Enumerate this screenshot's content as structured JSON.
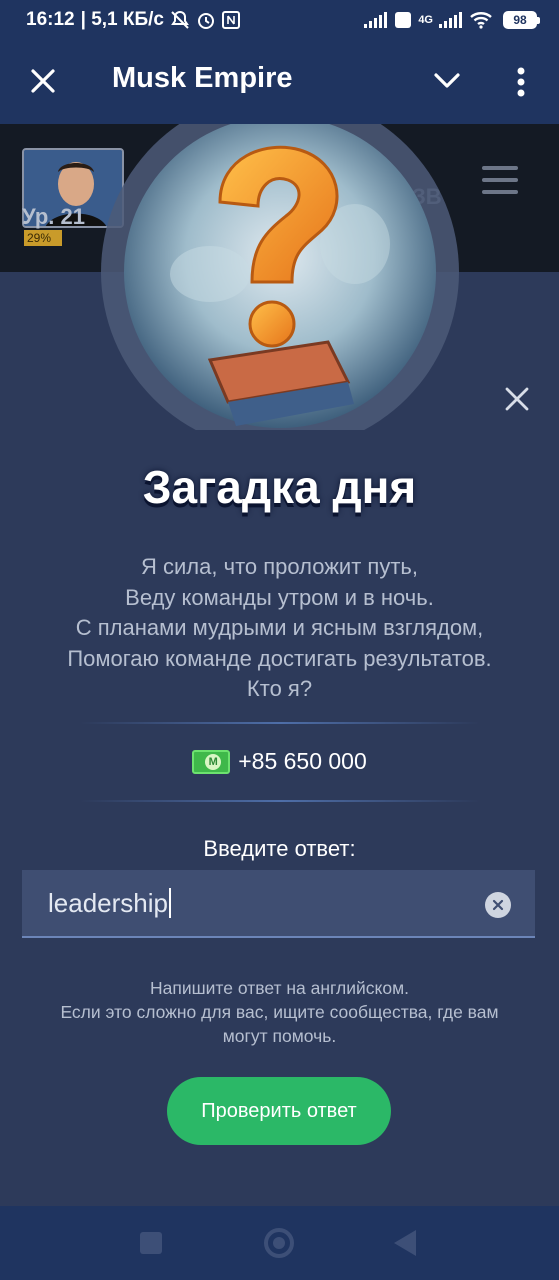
{
  "status_bar": {
    "time": "16:12",
    "network_speed": "| 5,1 КБ/с",
    "battery": "98",
    "network_type": "4G"
  },
  "app_bar": {
    "title": "Musk Empire"
  },
  "game_header": {
    "level": "Ур. 21",
    "level_progress": "29%",
    "faded_text": "ЗВ"
  },
  "modal": {
    "heading": "Загадка дня",
    "riddle_lines": [
      "Я сила, что проложит путь,",
      "Веду команды утром и в ночь.",
      "С планами мудрыми и ясным взглядом,",
      "Помогаю команде достигать результатов.",
      "Кто я?"
    ],
    "reward": "+85 650 000",
    "answer_label": "Введите ответ:",
    "answer_value": "leadership",
    "hint_lines": [
      "Напишите ответ на английском.",
      "Если это сложно для вас, ищите сообщества, где вам",
      "могут помочь."
    ],
    "check_button": "Проверить ответ"
  },
  "colors": {
    "accent_green": "#2bb867",
    "app_bar": "#1f3460",
    "modal_bg": "#2d3a5a"
  }
}
